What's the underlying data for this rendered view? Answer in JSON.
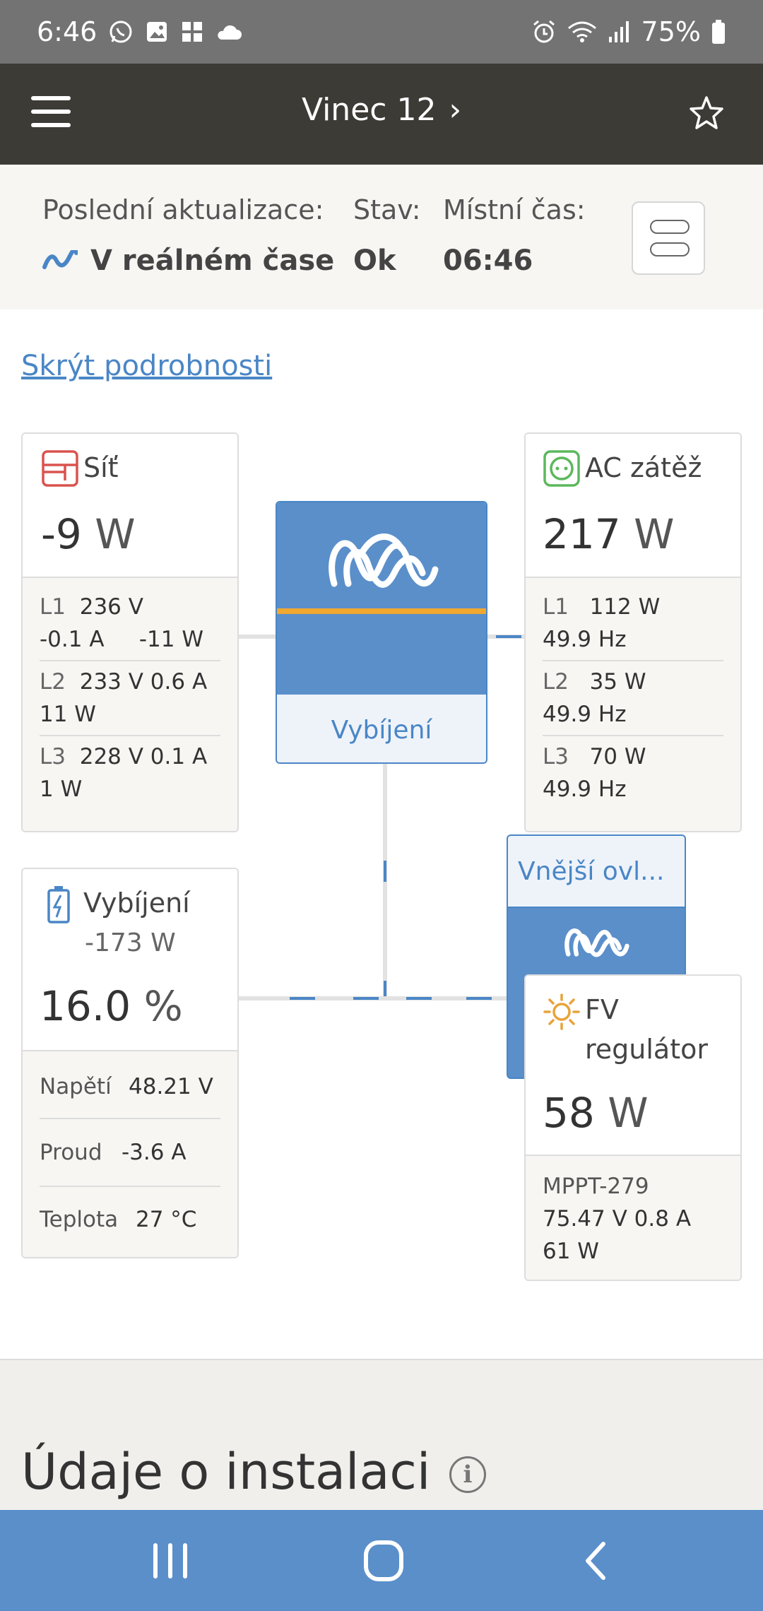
{
  "status_bar": {
    "time": "6:46",
    "battery": "75%",
    "left_icons": [
      "whatsapp-icon",
      "gallery-icon",
      "app-icon",
      "cloud-icon"
    ],
    "right_icons": [
      "alarm-icon",
      "wifi-icon",
      "signal-icon",
      "battery-icon"
    ]
  },
  "header": {
    "title": "Vinec 12",
    "chevron": "›"
  },
  "info": {
    "last_update_label": "Poslední aktualizace:",
    "last_update_value": "V reálném čase",
    "state_label": "Stav:",
    "state_value": "Ok",
    "local_time_label": "Místní čas:",
    "local_time_value": "06:46"
  },
  "hide_details": "Skrýt podrobnosti",
  "grid": {
    "title": "Síť",
    "value": "-9",
    "unit": "W",
    "phases": [
      {
        "name": "L1",
        "line1": "236 V",
        "line2a": "-0.1 A",
        "line2b": "-11 W"
      },
      {
        "name": "L2",
        "line1": "233 V   0.6 A",
        "line2a": "11 W"
      },
      {
        "name": "L3",
        "line1": "228 V   0.1 A",
        "line2a": "1 W"
      }
    ]
  },
  "ac_load": {
    "title": "AC zátěž",
    "value": "217",
    "unit": "W",
    "phases": [
      {
        "name": "L1",
        "power": "112 W",
        "freq": "49.9 Hz"
      },
      {
        "name": "L2",
        "power": "35 W",
        "freq": "49.9 Hz"
      },
      {
        "name": "L3",
        "power": "70 W",
        "freq": "49.9 Hz"
      }
    ]
  },
  "inverter": {
    "state": "Vybíjení"
  },
  "battery": {
    "title": "Vybíjení",
    "power": "-173 W",
    "value": "16.0",
    "unit": "%",
    "details": [
      {
        "label": "Napětí",
        "value": "48.21 V"
      },
      {
        "label": "Proud",
        "value": "-3.6 A"
      },
      {
        "label": "Teplota",
        "value": "27 °C"
      }
    ]
  },
  "external_control": {
    "label": "Vnější ovl..."
  },
  "pv_charger": {
    "title_line1": "FV",
    "title_line2": "regulátor",
    "value": "58",
    "unit": "W",
    "device": "MPPT-279",
    "line1": "75.47 V   0.8 A",
    "line2": "61 W"
  },
  "installation": {
    "title": "Údaje o instalaci"
  },
  "colors": {
    "accent": "#4a86c6",
    "header": "#3d3b36",
    "inverter_blue": "#5a8fca",
    "stripe": "#f0a830",
    "grid_icon": "#d9534f",
    "acload_icon": "#5cb85c",
    "pv_icon": "#e8a33a"
  }
}
